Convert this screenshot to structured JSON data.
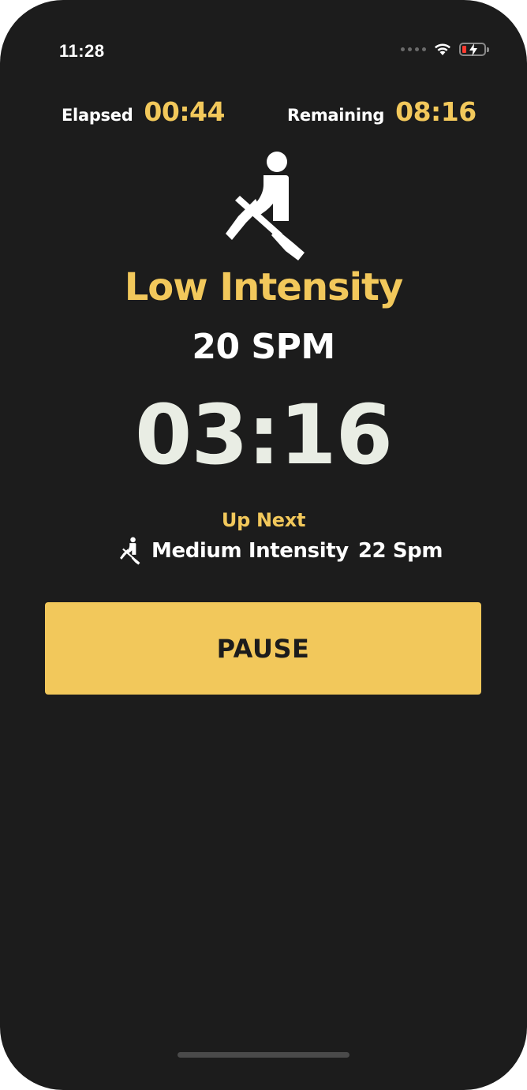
{
  "status_bar": {
    "time": "11:28",
    "icons": [
      "signal-dots-icon",
      "wifi-icon",
      "battery-low-charging-icon"
    ],
    "battery_color": "#ff3b30"
  },
  "timers": {
    "elapsed_label": "Elapsed",
    "elapsed_value": "00:44",
    "remaining_label": "Remaining",
    "remaining_value": "08:16"
  },
  "current": {
    "icon": "rower-icon",
    "intensity": "Low Intensity",
    "spm": "20 SPM",
    "countdown": "03:16"
  },
  "up_next": {
    "label": "Up Next",
    "icon": "rower-icon",
    "intensity": "Medium Intensity",
    "spm": "22 Spm"
  },
  "actions": {
    "pause_label": "PAUSE"
  },
  "colors": {
    "background": "#1c1c1c",
    "accent": "#f2c85b",
    "countdown": "#e9ede4",
    "text": "#ffffff"
  }
}
